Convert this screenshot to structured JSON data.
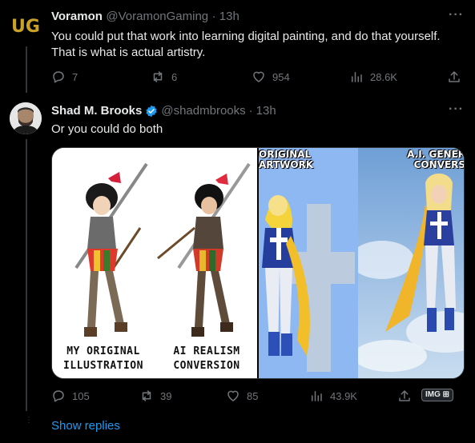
{
  "tweet1": {
    "name": "Voramon",
    "handle": "@VoramonGaming",
    "time": "13h",
    "text_line1": "You could put that work into learning digital painting, and do that yourself.",
    "text_line2": "That is what is actual artistry.",
    "avatar_logo": "UG",
    "replies": "7",
    "retweets": "6",
    "likes": "954",
    "views": "28.6K"
  },
  "tweet2": {
    "name": "Shad M. Brooks",
    "handle": "@shadmbrooks",
    "time": "13h",
    "text": "Or you could do both",
    "replies": "105",
    "retweets": "39",
    "likes": "85",
    "views": "43.9K",
    "badge": "IMG"
  },
  "media": {
    "caption_left_1": "MY ORIGINAL",
    "caption_left_2": "ILLUSTRATION",
    "caption_mid_1": "AI REALISM",
    "caption_mid_2": "CONVERSION",
    "title_right_a1": "ORIGINAL",
    "title_right_a2": "ARTWORK",
    "title_right_b1": "A.I. GENER",
    "title_right_b2": "CONVERS"
  },
  "show_replies": "Show replies",
  "colors": {
    "background": "#000000",
    "text": "#e7e9ea",
    "muted": "#71767b",
    "accent": "#1d9bf0",
    "logo_gold": "#c9a227"
  }
}
